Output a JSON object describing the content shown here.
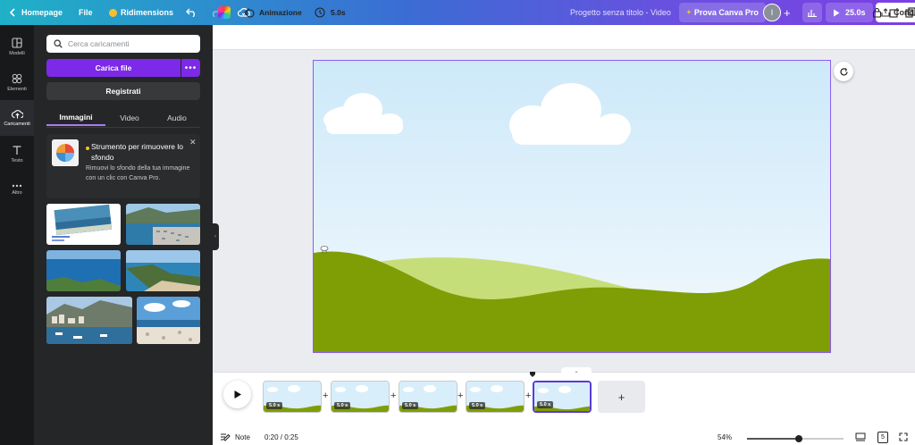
{
  "topbar": {
    "home_label": "Homepage",
    "file_label": "File",
    "resize_label": "Ridimensions",
    "project_title": "Progetto senza titolo - Video",
    "pro_label": "Prova Canva Pro",
    "avatar_initial": "I",
    "duration_label": "25.0s",
    "share_label": "Condi"
  },
  "rail": {
    "items": [
      {
        "label": "Modelli",
        "icon": "layout-icon"
      },
      {
        "label": "Elementi",
        "icon": "shapes-icon"
      },
      {
        "label": "Caricamenti",
        "icon": "cloud-upload-icon"
      },
      {
        "label": "Testo",
        "icon": "text-icon"
      },
      {
        "label": "Altro",
        "icon": "more-icon"
      }
    ]
  },
  "panel": {
    "search_placeholder": "Cerca caricamenti",
    "upload_label": "Carica file",
    "record_label": "Registrati",
    "tabs": [
      "Immagini",
      "Video",
      "Audio"
    ],
    "promo": {
      "title": "Strumento per rimuovere lo sfondo",
      "body": "Rimuovi lo sfondo della tua immagine con un clic con Canva Pro."
    }
  },
  "toolbar2": {
    "animation_label": "Animazione",
    "duration_label": "5.0s"
  },
  "timeline": {
    "clips": [
      {
        "duration": "5.0 s",
        "selected": false
      },
      {
        "duration": "5.0 s",
        "selected": false
      },
      {
        "duration": "5.0 s",
        "selected": false
      },
      {
        "duration": "5.0 s",
        "selected": false
      },
      {
        "duration": "5.0 s",
        "selected": true
      }
    ],
    "add_label": "+"
  },
  "bottom": {
    "notes_label": "Note",
    "time_label": "0:20 / 0:25",
    "zoom_label": "54%",
    "zoom_value": 0.54,
    "page_count": "5"
  },
  "colors": {
    "accent": "#7d2ae8",
    "sky_top": "#cde9f9",
    "hill_dark": "#7f9e06",
    "hill_light": "#c6de7a"
  }
}
